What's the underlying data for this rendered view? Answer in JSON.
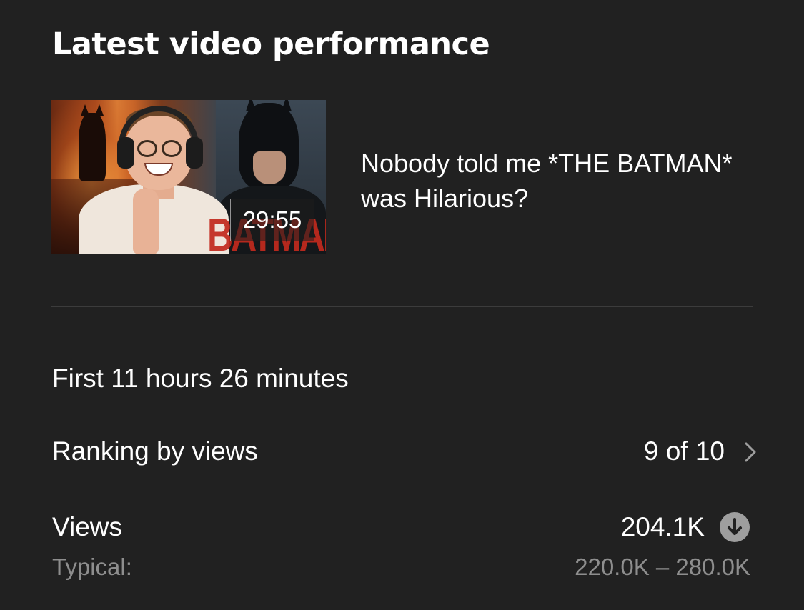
{
  "card": {
    "title": "Latest video performance"
  },
  "video": {
    "title": "Nobody told me *THE BATMAN* was Hilarious?",
    "duration": "29:55",
    "thumbnail_art_text": "BATMAN"
  },
  "period": "First 11 hours 26 minutes",
  "ranking": {
    "label": "Ranking by views",
    "value": "9 of 10",
    "icon": "chevron-right-icon"
  },
  "views": {
    "label": "Views",
    "value": "204.1K",
    "icon": "arrow-down-circle-icon",
    "typical_label": "Typical:",
    "typical_range": "220.0K – 280.0K"
  },
  "colors": {
    "background": "#212121",
    "text_primary": "#ffffff",
    "text_secondary": "#8e8e8e",
    "divider": "#3c3c3c",
    "icon_gray": "#9e9e9e"
  }
}
